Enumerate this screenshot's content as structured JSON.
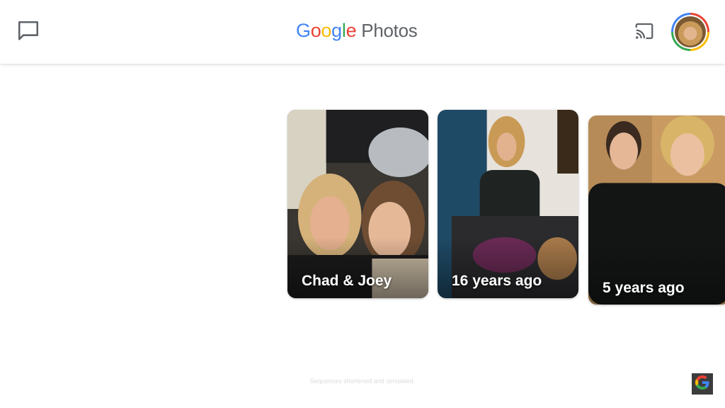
{
  "app": {
    "logo_letters": [
      "G",
      "o",
      "o",
      "g",
      "l",
      "e"
    ],
    "logo_colors": [
      "#4285F4",
      "#EA4335",
      "#FBBC05",
      "#4285F4",
      "#34A853",
      "#EA4335"
    ],
    "product_name": "Photos"
  },
  "header": {
    "feedback_icon": "message-square-icon",
    "cast_icon": "cast-icon",
    "avatar_icon": "account-avatar"
  },
  "memories": [
    {
      "title": "Chad & Joey"
    },
    {
      "title": "16 years ago"
    },
    {
      "title": "5 years ago"
    }
  ],
  "footer": {
    "disclaimer": "Sequences shortened and simulated."
  },
  "badge": {
    "icon": "google-g-icon"
  },
  "colors": {
    "header_bg": "#ffffff",
    "icon_gray": "#5f6368",
    "card_text": "#ffffff"
  }
}
